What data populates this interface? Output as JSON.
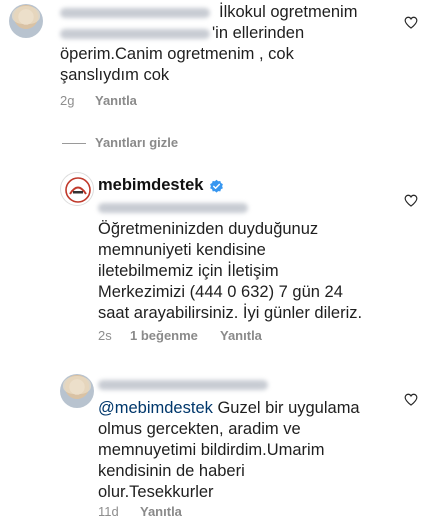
{
  "comment1": {
    "text_line1": "İlkokul ogretmenim",
    "text_line2": "'in ellerinden",
    "text_line3": "öperim.Canim ogretmenim , cok",
    "text_line4": "şanslıydım cok",
    "time": "2g",
    "reply": "Yanıtla"
  },
  "hide_replies": "Yanıtları gizle",
  "reply1": {
    "username": "mebimdestek",
    "lines": [
      "Öğretmeninizden duyduğunuz",
      "memnuniyeti kendisine",
      "iletebilmemiz için İletişim",
      "Merkezimizi (444 0 632) 7 gün 24",
      "saat arayabilirsiniz. İyi günler dileriz."
    ],
    "time": "2s",
    "likes": "1 beğenme",
    "reply": "Yanıtla"
  },
  "reply2": {
    "mention": "@mebimdestek",
    "line1_rest": " Guzel bir uygulama",
    "lines": [
      "olmus gercekten, aradim ve",
      "memnuyetimi bildirdim.Umarim",
      "kendisinin de haberi",
      "olur.Tesekkurler"
    ],
    "time": "11d",
    "reply": "Yanıtla"
  },
  "colors": {
    "text": "#1f1f1f",
    "meta": "#8e8e8e",
    "verified": "#3897f0",
    "mention": "#00376b"
  }
}
